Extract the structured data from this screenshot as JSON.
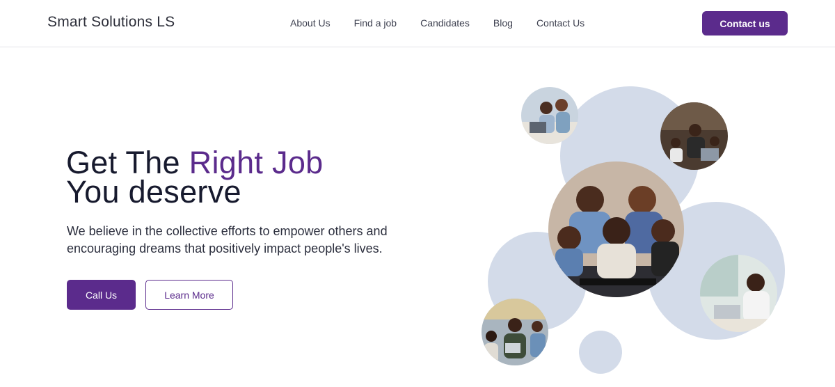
{
  "header": {
    "brand": "Smart Solutions LS",
    "nav": [
      "About Us",
      "Find a job",
      "Candidates",
      "Blog",
      "Contact Us"
    ],
    "cta": "Contact us"
  },
  "hero": {
    "title_prefix": "Get The ",
    "title_accent": "Right Job",
    "title_line2": "You deserve",
    "subtitle": "We believe in the collective efforts to empower others and encouraging dreams that positively impact people's lives.",
    "primary_button": "Call Us",
    "secondary_button": "Learn More"
  },
  "colors": {
    "brand_purple": "#5b2b8c",
    "bubble": "#d3dbe9",
    "text_dark": "#171a2e"
  }
}
